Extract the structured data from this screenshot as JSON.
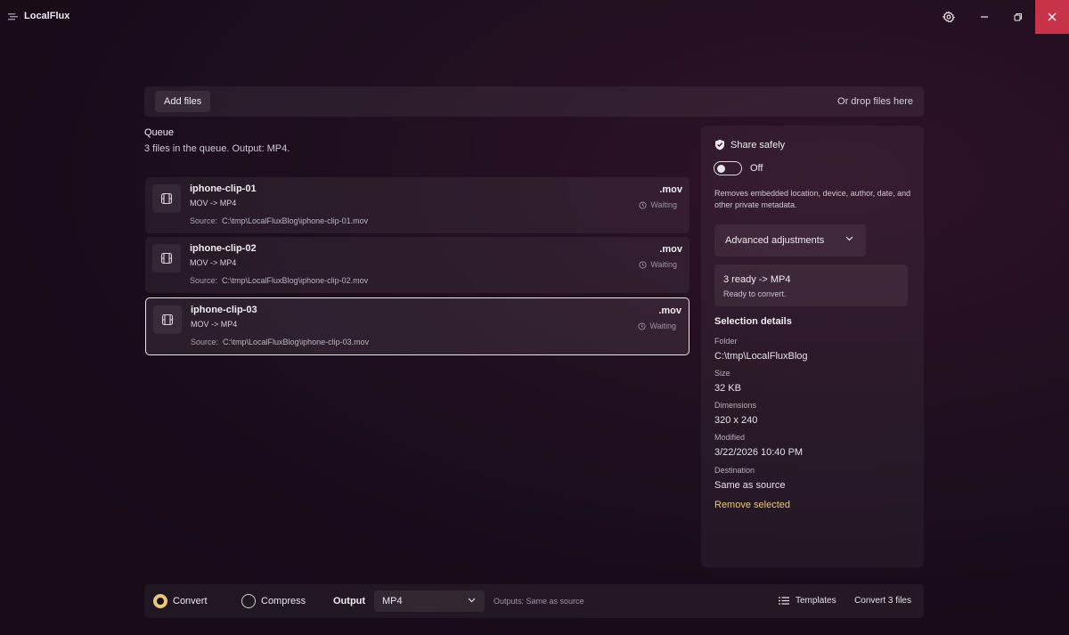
{
  "app": {
    "title": "LocalFlux"
  },
  "dropzone": {
    "add_label": "Add files",
    "drop_hint": "Or drop files here"
  },
  "queue": {
    "title": "Queue",
    "summary": "3 files in the queue. Output: MP4.",
    "source_label": "Source:",
    "items": [
      {
        "name": "iphone-clip-01",
        "conversion": "MOV -> MP4",
        "source": "C:\\tmp\\LocalFluxBlog\\iphone-clip-01.mov",
        "ext": ".mov",
        "status": "Waiting"
      },
      {
        "name": "iphone-clip-02",
        "conversion": "MOV -> MP4",
        "source": "C:\\tmp\\LocalFluxBlog\\iphone-clip-02.mov",
        "ext": ".mov",
        "status": "Waiting"
      },
      {
        "name": "iphone-clip-03",
        "conversion": "MOV -> MP4",
        "source": "C:\\tmp\\LocalFluxBlog\\iphone-clip-03.mov",
        "ext": ".mov",
        "status": "Waiting"
      }
    ]
  },
  "panel": {
    "share_title": "Share safely",
    "toggle_label": "Off",
    "share_desc": "Removes embedded location, device, author, date, and other private metadata.",
    "advanced_label": "Advanced adjustments",
    "ready_title": "3 ready -> MP4",
    "ready_sub": "Ready to convert.",
    "selection_title": "Selection details",
    "details": {
      "folder_label": "Folder",
      "folder": "C:\\tmp\\LocalFluxBlog",
      "size_label": "Size",
      "size": "32 KB",
      "dimensions_label": "Dimensions",
      "dimensions": "320 x 240",
      "modified_label": "Modified",
      "modified": "3/22/2026 10:40 PM",
      "destination_label": "Destination",
      "destination": "Same as source"
    },
    "remove_label": "Remove selected"
  },
  "bottom": {
    "convert_label": "Convert",
    "compress_label": "Compress",
    "output_label": "Output",
    "output_value": "MP4",
    "outputs_note": "Outputs: Same as source",
    "templates_label": "Templates",
    "convert_button": "Convert 3 files"
  },
  "colors": {
    "accent": "#e8c87a",
    "close": "#c8334a"
  },
  "icons": {
    "settings": "gear-icon",
    "minimize": "minimize-icon",
    "restore": "restore-icon",
    "close": "close-icon",
    "file": "film-icon",
    "status": "clock-icon",
    "share": "shield-icon"
  }
}
